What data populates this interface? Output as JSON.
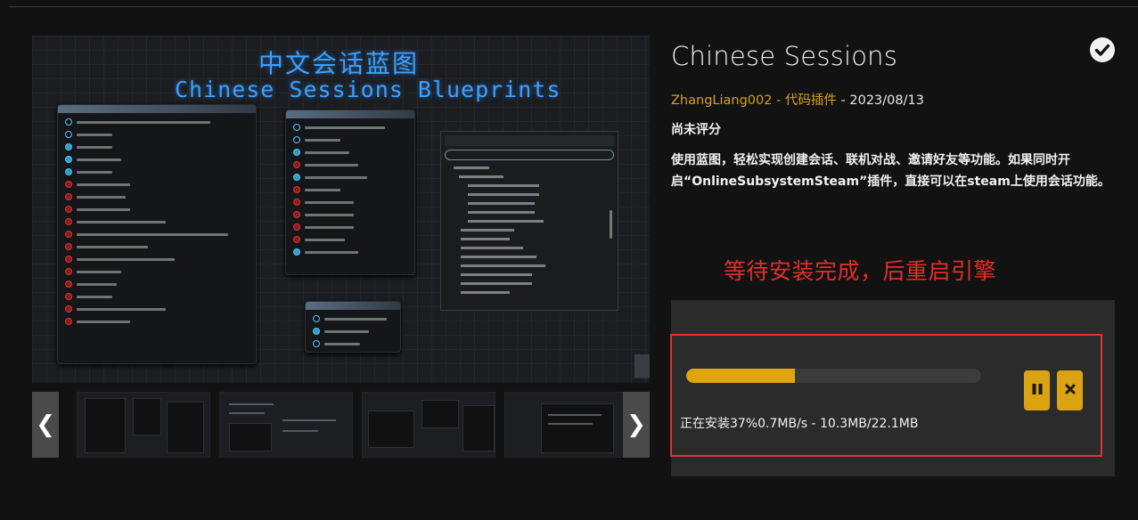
{
  "preview": {
    "title_cn": "中文会话蓝图",
    "title_en": "Chinese Sessions Blueprints"
  },
  "gallery": {
    "prev_icon": "chevron-left-icon",
    "next_icon": "chevron-right-icon",
    "prev_glyph": "❮",
    "next_glyph": "❯"
  },
  "plugin": {
    "name": "Chinese Sessions",
    "author": "ZhangLiang002",
    "separator": " - ",
    "category": "代码插件",
    "date": "2023/08/13",
    "rating": "尚未评分",
    "description": "使用蓝图，轻松实现创建会话、联机对战、邀请好友等功能。如果同时开启“OnlineSubsystemSteam”插件，直接可以在steam上使用会话功能。",
    "installed_icon": "check-circle-icon"
  },
  "notice": "等待安装完成，后重启引擎",
  "download": {
    "progress_fraction": 0.37,
    "status_text": "正在安装37%0.7MB/s - 10.3MB/22.1MB",
    "pause_icon": "pause-icon",
    "cancel_icon": "close-icon"
  },
  "colors": {
    "accent": "#d8a119",
    "progress": "#e0a40f",
    "notice": "#e0302a",
    "highlight_border": "#d93535",
    "panel": "#2b2b2b",
    "background": "#121212"
  }
}
